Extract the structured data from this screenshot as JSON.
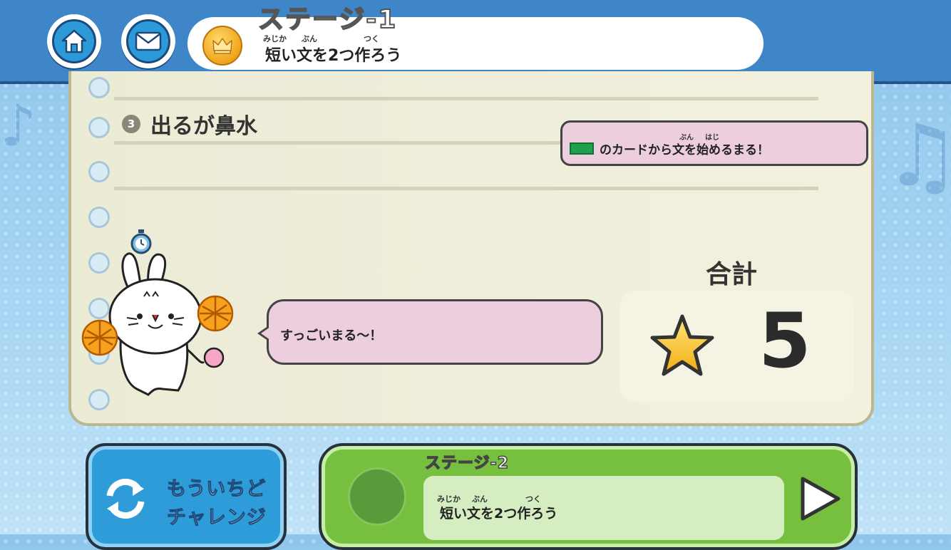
{
  "header": {
    "home_icon": "home-icon",
    "mail_icon": "mail-icon",
    "coin_icon": "crown-coin-icon",
    "stage_title": "ステージ-1",
    "task_ruby": [
      "みじか",
      "ぶん",
      "つく"
    ],
    "task_text": "短い文を2つ作ろう"
  },
  "notebook": {
    "item_number": "3",
    "sentence": "出るが鼻水",
    "hint": {
      "chip_color": "#1fa14b",
      "ruby": [
        "ぶん",
        "はじ"
      ],
      "text": "のカードから文を始めるまる！"
    },
    "speech": "すっごいまる〜！",
    "total_label": "合計",
    "total_value": "5",
    "star_icon": "star-icon"
  },
  "bottom": {
    "retry_line1": "もういちど",
    "retry_line2": "チャレンジ",
    "retry_icon": "refresh-icon",
    "next_stage_title": "ステージ-2",
    "next_ruby": [
      "みじか",
      "ぶん",
      "つく"
    ],
    "next_task": "短い文を2つ作ろう",
    "next_icon": "play-arrow-icon"
  },
  "colors": {
    "header_blue": "#3f86c8",
    "notebook_bg": "#ecebd6",
    "bubble_pink": "#edcedf",
    "next_green": "#77bf3e",
    "retry_blue": "#2d9cd8"
  }
}
